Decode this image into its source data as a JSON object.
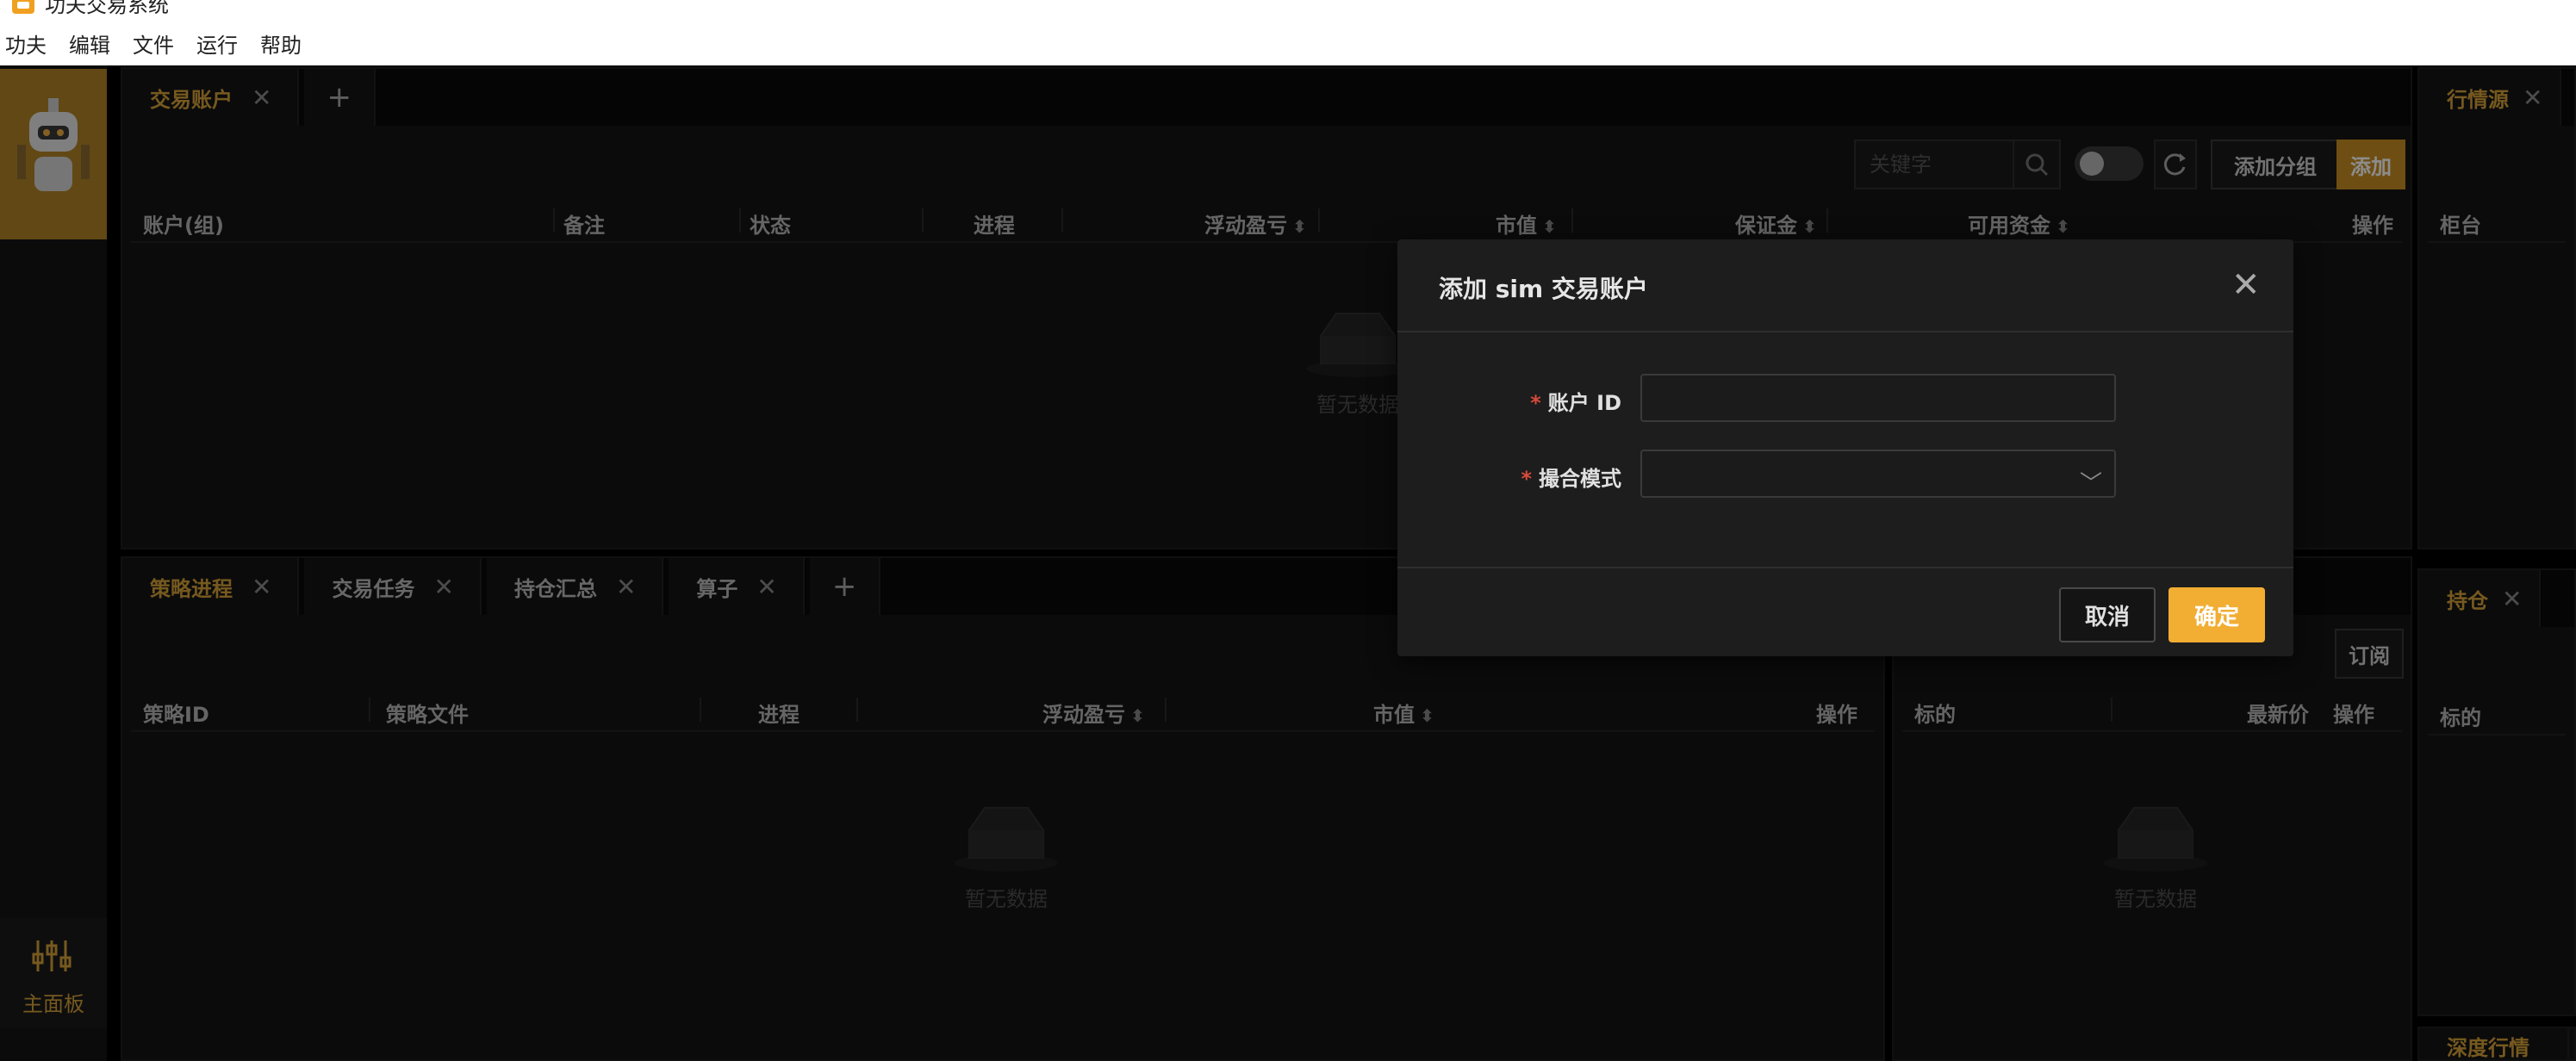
{
  "window": {
    "title": "功夫交易系统"
  },
  "menubar": {
    "items": [
      "功夫",
      "编辑",
      "文件",
      "运行",
      "帮助"
    ]
  },
  "sidebar": {
    "nav": {
      "label": "主面板"
    }
  },
  "accounts_panel": {
    "tab": "交易账户",
    "search_placeholder": "关键字",
    "add_group_label": "添加分组",
    "add_label": "添加",
    "columns": [
      "账户(组)",
      "备注",
      "状态",
      "进程",
      "浮动盈亏",
      "市值",
      "保证金",
      "可用资金",
      "操作"
    ],
    "empty_text": "暂无数据"
  },
  "market_panel": {
    "tab": "行情源",
    "column": "柜台"
  },
  "strategy_panel": {
    "tabs": [
      "策略进程",
      "交易任务",
      "持仓汇总",
      "算子"
    ],
    "columns": [
      "策略ID",
      "策略文件",
      "进程",
      "浮动盈亏",
      "市值",
      "操作"
    ],
    "empty_text": "暂无数据"
  },
  "quote_panel": {
    "subscribe_label": "订阅",
    "columns": [
      "标的",
      "最新价",
      "操作"
    ],
    "empty_text": "暂无数据"
  },
  "position_panel": {
    "tab": "持仓",
    "column": "标的"
  },
  "depth_panel": {
    "tab": "深度行情"
  },
  "modal": {
    "title": "添加 sim 交易账户",
    "fields": [
      {
        "label": "账户 ID",
        "value": ""
      },
      {
        "label": "撮合模式",
        "value": ""
      }
    ],
    "cancel_label": "取消",
    "ok_label": "确定"
  }
}
